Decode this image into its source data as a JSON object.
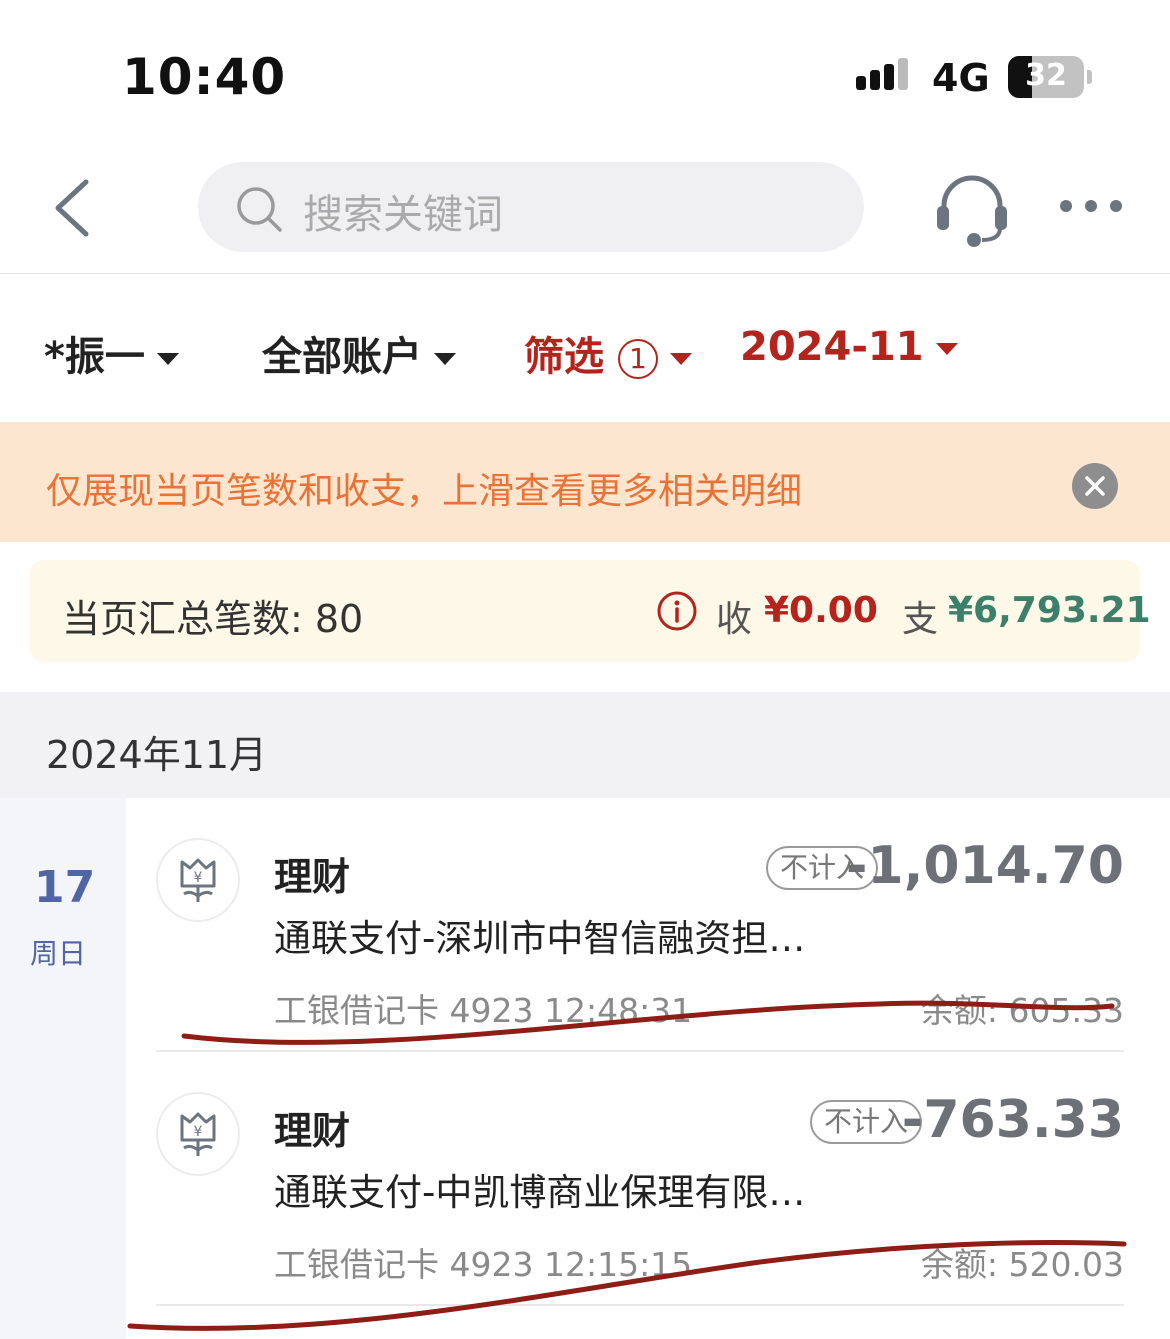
{
  "status_bar": {
    "time": "10:40",
    "network": "4G",
    "battery": "32",
    "battery_level": 0.32
  },
  "search": {
    "placeholder": "搜索关键词"
  },
  "filters": {
    "user": "*振一",
    "account": "全部账户",
    "filter_label": "筛选",
    "filter_count": "1",
    "month": "2024-11"
  },
  "notice": {
    "text": "仅展现当页笔数和收支，上滑查看更多相关明细"
  },
  "summary": {
    "count_label": "当页汇总笔数: 80",
    "income_label": "收",
    "income_value": "¥0.00",
    "expense_label": "支",
    "expense_value": "¥6,793.21"
  },
  "month_header": "2024年11月",
  "day": {
    "number": "17",
    "weekday": "周日"
  },
  "transactions": [
    {
      "category": "理财",
      "description": "通联支付-深圳市中智信融资担…",
      "badge": "不计入",
      "amount": "-1,014.70",
      "meta": "工银借记卡 4923 12:48:31",
      "balance": "余额: 605.33"
    },
    {
      "category": "理财",
      "description": "通联支付-中凯博商业保理有限…",
      "badge": "不计入",
      "amount": "-763.33",
      "meta": "工银借记卡 4923 12:15:15",
      "balance": "余额: 520.03"
    }
  ],
  "colors": {
    "accent_red": "#b4231c",
    "notice_text": "#e97336",
    "notice_bg": "#fce6cf",
    "expense_green": "#3c7f6a",
    "date_blue": "#4f65a4"
  }
}
